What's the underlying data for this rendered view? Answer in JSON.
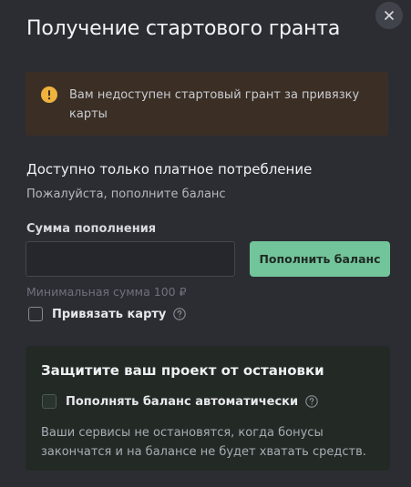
{
  "modal": {
    "title": "Получение стартового гранта"
  },
  "warning": {
    "text": "Вам недоступен стартовый грант за привязку карты",
    "color": "#3b2f25",
    "icon": "warning-circle-icon"
  },
  "paid_section": {
    "heading": "Доступно только платное потребление",
    "subtext": "Пожалуйста, пополните баланс",
    "amount_label": "Сумма пополнения",
    "amount_value": "",
    "amount_placeholder": "",
    "topup_button": "Пополнить баланс",
    "min_hint": "Минимальная сумма 100 ₽",
    "bind_card_label": "Привязать карту",
    "bind_card_checked": false
  },
  "protect": {
    "title": "Защитите ваш проект от остановки",
    "auto_topup_label": "Пополнять баланс автоматически",
    "auto_topup_checked": false,
    "description": "Ваши сервисы не остановятся, когда бонусы закончатся и на балансе не будет хватать средств."
  },
  "colors": {
    "background": "#2c2d33",
    "accent": "#72c49a",
    "warning_icon": "#f0b23e"
  }
}
